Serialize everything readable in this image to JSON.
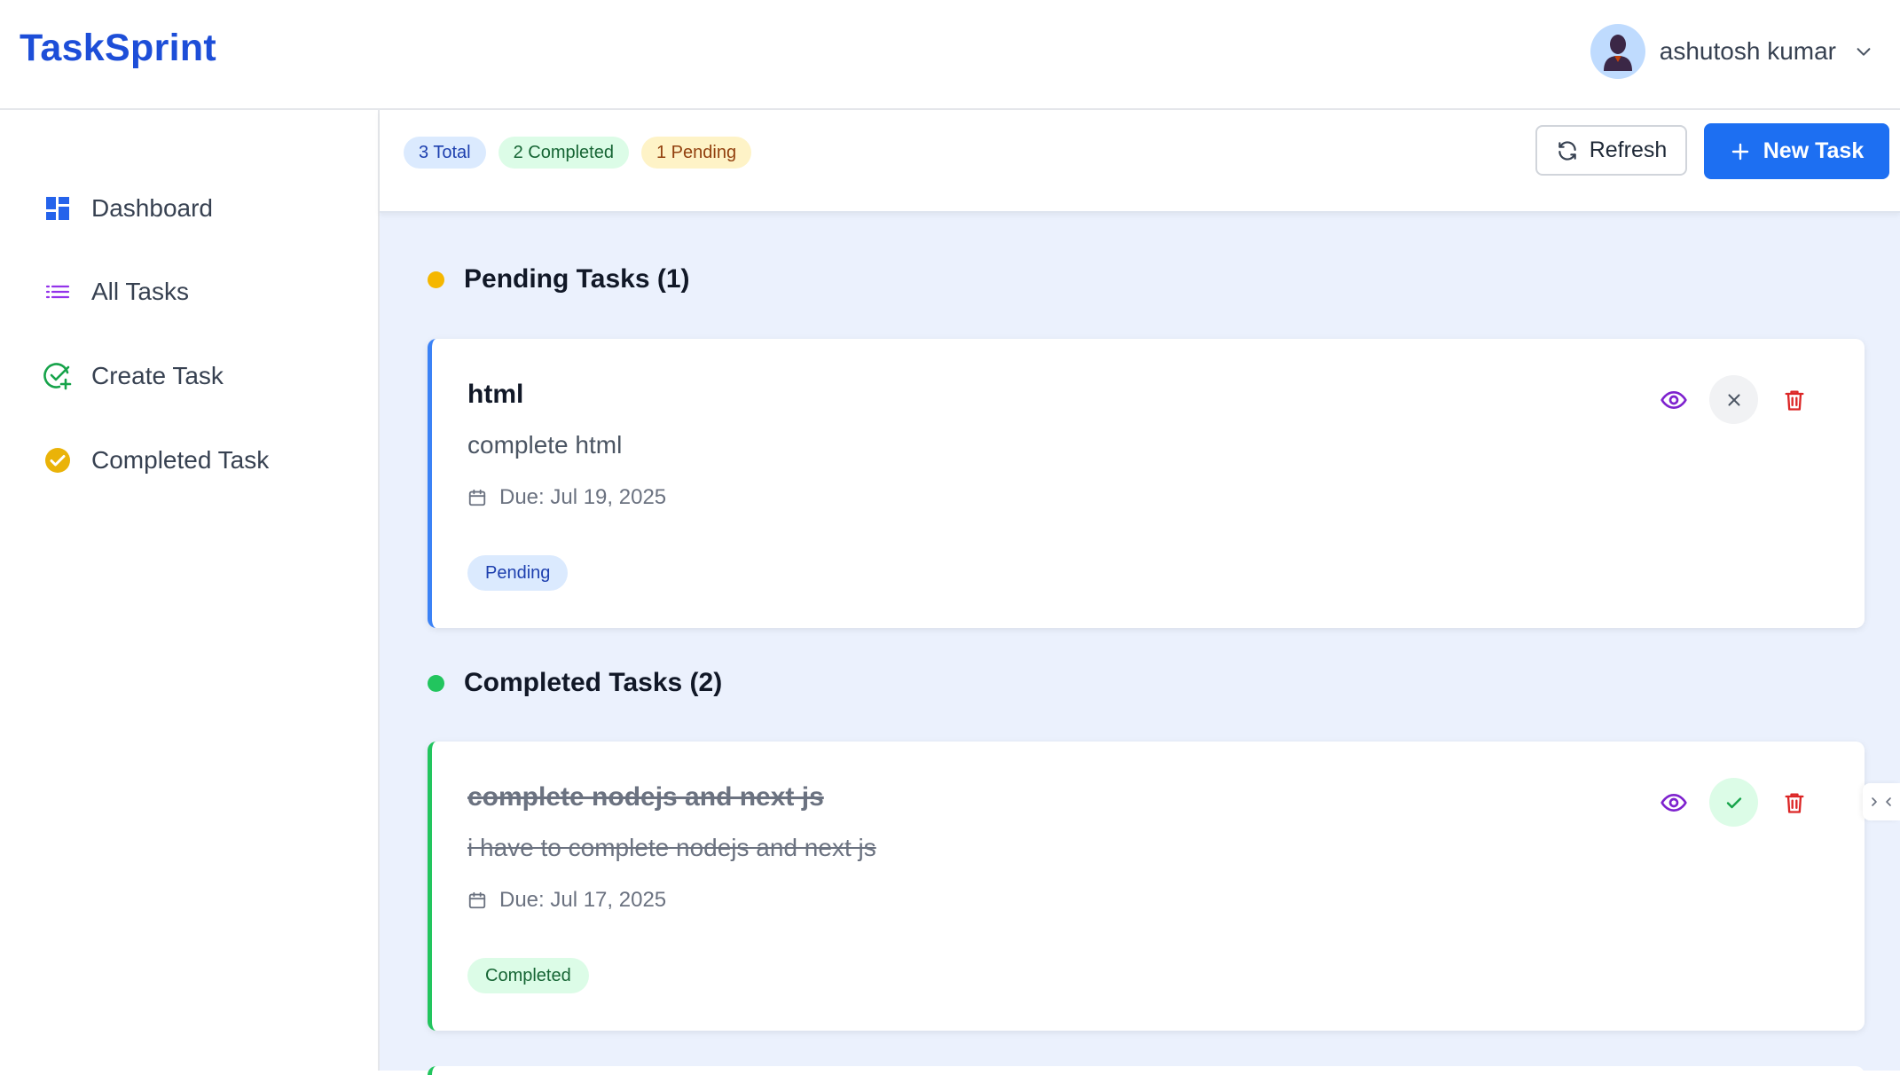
{
  "app": {
    "title": "TaskSprint"
  },
  "user": {
    "name": "ashutosh kumar"
  },
  "sidebar": {
    "items": [
      {
        "label": "Dashboard",
        "icon": "dashboard-icon"
      },
      {
        "label": "All Tasks",
        "icon": "list-icon"
      },
      {
        "label": "Create Task",
        "icon": "check-plus-icon"
      },
      {
        "label": "Completed Task",
        "icon": "check-circle-icon"
      }
    ]
  },
  "stats": {
    "total": "3 Total",
    "completed": "2 Completed",
    "pending": "1 Pending"
  },
  "toolbar": {
    "refresh_label": "Refresh",
    "new_task_label": "New Task"
  },
  "sections": {
    "pending": {
      "title": "Pending Tasks (1)",
      "tasks": [
        {
          "title": "html",
          "description": "complete html",
          "due": "Due: Jul 19, 2025",
          "status": "Pending"
        }
      ]
    },
    "completed": {
      "title": "Completed Tasks (2)",
      "tasks": [
        {
          "title": "complete nodejs and next js",
          "description": "i have to complete nodejs and next js",
          "due": "Due: Jul 17, 2025",
          "status": "Completed"
        }
      ]
    }
  },
  "colors": {
    "brand": "#1d4ed8",
    "primary_button": "#1d6ff2",
    "pending_dot": "#f5b700",
    "completed_dot": "#22c55e",
    "delete_icon": "#dc2626",
    "view_icon": "#7e22ce"
  }
}
